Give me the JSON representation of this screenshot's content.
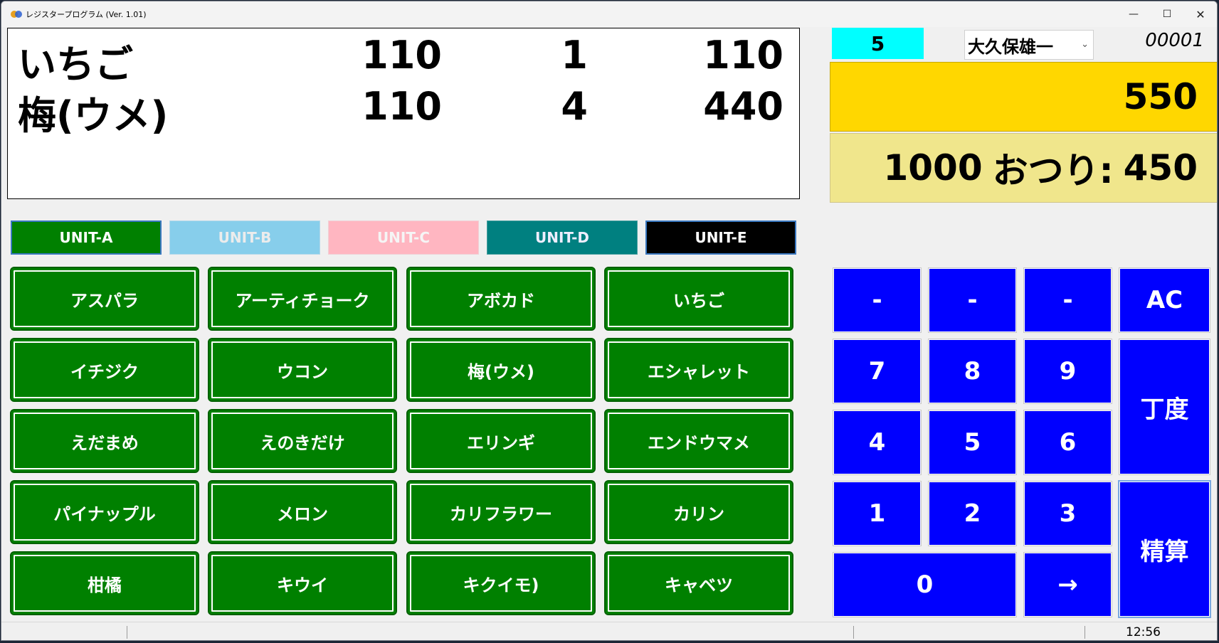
{
  "window": {
    "title": "レジスタープログラム (Ver. 1.01)",
    "controls": {
      "minimize": "—",
      "maximize": "☐",
      "close": "✕"
    }
  },
  "receipt": {
    "rows": [
      {
        "name": "いちご",
        "price": "110",
        "qty": "1",
        "subtotal": "110"
      },
      {
        "name": "梅(ウメ)",
        "price": "110",
        "qty": "4",
        "subtotal": "440"
      }
    ]
  },
  "units": [
    {
      "label": "UNIT-A"
    },
    {
      "label": "UNIT-B"
    },
    {
      "label": "UNIT-C"
    },
    {
      "label": "UNIT-D"
    },
    {
      "label": "UNIT-E"
    }
  ],
  "products": [
    "アスパラ",
    "アーティチョーク",
    "アボカド",
    "いちご",
    "イチジク",
    "ウコン",
    "梅(ウメ)",
    "エシャレット",
    "えだまめ",
    "えのきだけ",
    "エリンギ",
    "エンドウマメ",
    "パイナップル",
    "メロン",
    "カリフラワー",
    "カリン",
    "柑橘",
    "キウイ",
    "キクイモ)",
    "キャベツ"
  ],
  "info": {
    "item_count": "5",
    "staff_name": "大久保雄一",
    "transaction_no": "00001",
    "total": "550",
    "tendered": "1000",
    "change_label": "おつり:",
    "change": "450"
  },
  "keypad": {
    "dash1": "-",
    "dash2": "-",
    "dash3": "-",
    "ac": "AC",
    "k7": "7",
    "k8": "8",
    "k9": "9",
    "exact": "丁度",
    "k4": "4",
    "k5": "5",
    "k6": "6",
    "k1": "1",
    "k2": "2",
    "k3": "3",
    "checkout": "精算",
    "k0": "0",
    "arrow": "→"
  },
  "status": {
    "time": "12:56"
  },
  "colors": {
    "product_green": "#008000",
    "key_blue": "#0000ff",
    "total_yellow": "#ffd700",
    "change_khaki": "#f0e68c",
    "count_cyan": "#00ffff"
  }
}
